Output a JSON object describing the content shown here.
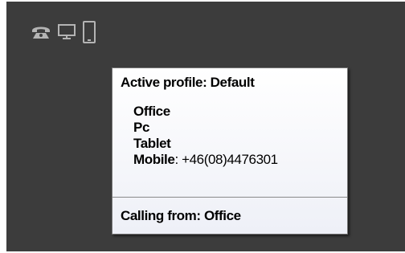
{
  "toolbar": {
    "icons": [
      "phone-icon",
      "monitor-icon",
      "tablet-icon"
    ]
  },
  "tooltip": {
    "title": "Active profile: Default",
    "devices": [
      {
        "name": "Office"
      },
      {
        "name": "Pc"
      },
      {
        "name": "Tablet"
      },
      {
        "name": "Mobile",
        "separator": ":",
        "value": " +46(08)4476301"
      }
    ],
    "footer": "Calling from: Office"
  },
  "colors": {
    "panel_background": "#3c3c3c",
    "icon_color": "#b4b4b4",
    "tooltip_border": "#767676"
  }
}
